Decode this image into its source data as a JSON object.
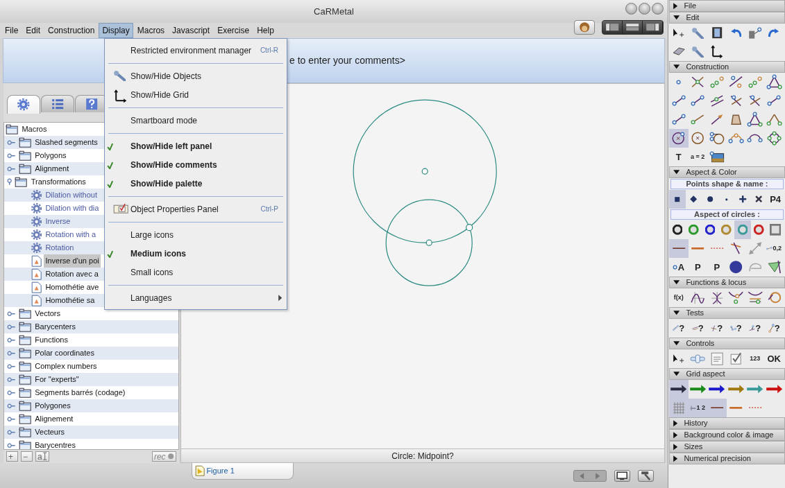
{
  "window": {
    "title": "CaRMetal"
  },
  "menubar": [
    {
      "label": "File",
      "selected": false
    },
    {
      "label": "Edit",
      "selected": false
    },
    {
      "label": "Construction",
      "selected": false
    },
    {
      "label": "Display",
      "selected": true
    },
    {
      "label": "Macros",
      "selected": false
    },
    {
      "label": "Javascript",
      "selected": false
    },
    {
      "label": "Exercise",
      "selected": false
    },
    {
      "label": "Help",
      "selected": false
    }
  ],
  "display_menu": {
    "items": [
      {
        "kind": "item",
        "label": "Restricted environment manager",
        "shortcut": "Ctrl-R",
        "checked": false
      },
      {
        "kind": "separator"
      },
      {
        "kind": "item",
        "label": "Show/Hide Objects",
        "checked": false
      },
      {
        "kind": "item",
        "label": "Show/Hide Grid",
        "checked": false
      },
      {
        "kind": "separator"
      },
      {
        "kind": "item",
        "label": "Smartboard mode",
        "checked": false
      },
      {
        "kind": "separator"
      },
      {
        "kind": "item",
        "label": "Show/Hide left panel",
        "checked": true
      },
      {
        "kind": "item",
        "label": "Show/Hide comments",
        "checked": true
      },
      {
        "kind": "item",
        "label": "Show/Hide palette",
        "checked": true
      },
      {
        "kind": "separator"
      },
      {
        "kind": "item",
        "label": "Object Properties Panel",
        "shortcut": "Ctrl-P",
        "checked": false
      },
      {
        "kind": "separator"
      },
      {
        "kind": "item",
        "label": "Large icons",
        "checked": false
      },
      {
        "kind": "item",
        "label": "Medium icons",
        "checked": true
      },
      {
        "kind": "item",
        "label": "Small icons",
        "checked": false
      },
      {
        "kind": "separator"
      },
      {
        "kind": "item",
        "label": "Languages",
        "submenu": true,
        "checked": false
      }
    ]
  },
  "comments": {
    "text": "e to enter your comments>"
  },
  "left_panel": {
    "tabs": [
      {
        "selected": true
      },
      {
        "selected": false
      },
      {
        "selected": false
      }
    ],
    "tree": [
      {
        "label": "Macros",
        "expanded": true,
        "selected": false,
        "children": [
          {
            "label": "Slashed segments",
            "kind": "folder",
            "expanded": false,
            "selected": false
          },
          {
            "label": "Polygons",
            "kind": "folder",
            "expanded": false,
            "selected": false
          },
          {
            "label": "Alignment",
            "kind": "folder",
            "expanded": false,
            "selected": false
          },
          {
            "label": "Transformations",
            "kind": "folder",
            "expanded": true,
            "selected": false,
            "children": [
              {
                "label": "Dilation without",
                "kind": "builtin",
                "selected": false
              },
              {
                "label": "Dilation with dia",
                "kind": "builtin",
                "selected": false
              },
              {
                "label": "Inverse",
                "kind": "builtin",
                "selected": false
              },
              {
                "label": "Rotation with a",
                "kind": "builtin",
                "selected": false
              },
              {
                "label": "Rotation",
                "kind": "builtin",
                "selected": false
              },
              {
                "label": "Inverse d'un poi",
                "kind": "user",
                "selected": true
              },
              {
                "label": "Rotation avec a",
                "kind": "user",
                "selected": false
              },
              {
                "label": "Homothétie ave",
                "kind": "user",
                "selected": false
              },
              {
                "label": "Homothétie sa",
                "kind": "user",
                "selected": false
              }
            ]
          },
          {
            "label": "Vectors",
            "kind": "folder",
            "expanded": false,
            "selected": false
          },
          {
            "label": "Barycenters",
            "kind": "folder",
            "expanded": false,
            "selected": false
          },
          {
            "label": "Functions",
            "kind": "folder",
            "expanded": false,
            "selected": false
          },
          {
            "label": "Polar coordinates",
            "kind": "folder",
            "expanded": false,
            "selected": false
          },
          {
            "label": "Complex numbers",
            "kind": "folder",
            "expanded": false,
            "selected": false
          },
          {
            "label": "For \"experts\"",
            "kind": "folder",
            "expanded": false,
            "selected": false
          },
          {
            "label": "Segments barrés (codage)",
            "kind": "folder",
            "expanded": false,
            "selected": false
          },
          {
            "label": "Polygones",
            "kind": "folder",
            "expanded": false,
            "selected": false
          },
          {
            "label": "Alignement",
            "kind": "folder",
            "expanded": false,
            "selected": false
          },
          {
            "label": "Vecteurs",
            "kind": "folder",
            "expanded": false,
            "selected": false
          },
          {
            "label": "Barycentres",
            "kind": "folder",
            "expanded": false,
            "selected": false
          }
        ]
      }
    ],
    "buttons": [
      {
        "label": "+"
      },
      {
        "label": "−"
      },
      {
        "label": "a"
      },
      {
        "label": "rec"
      }
    ]
  },
  "status": "Circle: Midpoint?",
  "document_tabs": [
    {
      "label": "Figure 1",
      "selected": true
    }
  ],
  "palette": [
    {
      "title": "File",
      "expanded": false
    },
    {
      "title": "Edit",
      "expanded": true,
      "groups": [
        {
          "tools": [
            {
              "selected": false
            },
            {
              "selected": false
            },
            {
              "selected": false
            },
            {
              "selected": false
            },
            {
              "selected": false
            },
            {
              "selected": false
            },
            {
              "selected": false
            },
            {
              "selected": false
            },
            {
              "selected": false
            }
          ]
        }
      ]
    },
    {
      "title": "Construction",
      "expanded": true,
      "groups": [
        {
          "tools": [
            {
              "selected": false
            },
            {
              "selected": false
            },
            {
              "selected": false
            },
            {
              "selected": false
            },
            {
              "selected": false
            },
            {
              "selected": false
            },
            {
              "selected": false
            },
            {
              "selected": false
            },
            {
              "selected": false
            },
            {
              "selected": false
            },
            {
              "selected": false
            },
            {
              "selected": false
            },
            {
              "selected": false
            },
            {
              "selected": false
            },
            {
              "selected": false
            },
            {
              "selected": false
            },
            {
              "selected": false
            },
            {
              "selected": false
            },
            {
              "selected": true
            },
            {
              "selected": false
            },
            {
              "selected": false
            },
            {
              "selected": false
            },
            {
              "selected": false
            },
            {
              "selected": false
            },
            {
              "selected": false,
              "label": "T"
            },
            {
              "selected": false,
              "label": "a = 2"
            },
            {
              "selected": false
            }
          ]
        }
      ]
    },
    {
      "title": "Aspect & Color",
      "expanded": true,
      "groups": [
        {
          "heading": "Points shape & name :",
          "tools": [
            {
              "selected": true
            },
            {
              "selected": false
            },
            {
              "selected": false
            },
            {
              "selected": false
            },
            {
              "selected": false
            },
            {
              "selected": false
            },
            {
              "selected": false,
              "label": "P4"
            }
          ]
        },
        {
          "heading": "Aspect of circles :",
          "tools": [
            {
              "selected": false,
              "color": "#222222"
            },
            {
              "selected": false,
              "color": "#2a9a2a"
            },
            {
              "selected": false,
              "color": "#2222cc"
            },
            {
              "selected": false,
              "color": "#b08a30"
            },
            {
              "selected": true,
              "color": "#3a9a9a"
            },
            {
              "selected": false,
              "color": "#cc2222"
            },
            {
              "selected": false
            }
          ]
        },
        {
          "tools": [
            {
              "selected": true
            },
            {
              "selected": false
            },
            {
              "selected": false
            },
            {
              "selected": false
            },
            {
              "selected": false
            },
            {
              "selected": false,
              "label": "0,2"
            }
          ]
        },
        {
          "tools": [
            {
              "selected": false,
              "label": "A"
            },
            {
              "selected": false,
              "label": "P"
            },
            {
              "selected": false,
              "label": "P"
            },
            {
              "selected": false
            },
            {
              "selected": false
            },
            {
              "selected": false
            }
          ]
        }
      ]
    },
    {
      "title": "Functions & locus",
      "expanded": true,
      "groups": [
        {
          "tools": [
            {
              "selected": false,
              "label": "f(x)"
            },
            {
              "selected": false
            },
            {
              "selected": false
            },
            {
              "selected": false
            },
            {
              "selected": false
            },
            {
              "selected": false
            }
          ]
        }
      ]
    },
    {
      "title": "Tests",
      "expanded": true,
      "groups": [
        {
          "tools": [
            {
              "selected": false,
              "label": "?"
            },
            {
              "selected": false,
              "label": "?"
            },
            {
              "selected": false,
              "label": "?"
            },
            {
              "selected": false,
              "label": "?"
            },
            {
              "selected": false,
              "label": "?"
            },
            {
              "selected": false,
              "label": "?"
            }
          ]
        }
      ]
    },
    {
      "title": "Controls",
      "expanded": true,
      "groups": [
        {
          "tools": [
            {
              "selected": false
            },
            {
              "selected": false
            },
            {
              "selected": false
            },
            {
              "selected": false
            },
            {
              "selected": false,
              "label": "123"
            },
            {
              "selected": false,
              "label": "OK"
            }
          ]
        }
      ]
    },
    {
      "title": "Grid aspect",
      "expanded": true,
      "groups": [
        {
          "tools": [
            {
              "selected": true,
              "color": "#2a2a40"
            },
            {
              "selected": false,
              "color": "#1a8a1a"
            },
            {
              "selected": false,
              "color": "#1a1acc"
            },
            {
              "selected": false,
              "color": "#a07a10"
            },
            {
              "selected": false,
              "color": "#3a9a9a"
            },
            {
              "selected": false,
              "color": "#cc1010"
            }
          ]
        },
        {
          "tools": [
            {
              "selected": true
            },
            {
              "selected": true,
              "label": "1 2"
            },
            {
              "selected": true
            },
            {
              "selected": false
            },
            {
              "selected": false
            }
          ]
        }
      ]
    },
    {
      "title": "History",
      "expanded": false
    },
    {
      "title": "Background color & image",
      "expanded": false
    },
    {
      "title": "Sizes",
      "expanded": false
    },
    {
      "title": "Numerical precision",
      "expanded": false
    }
  ]
}
